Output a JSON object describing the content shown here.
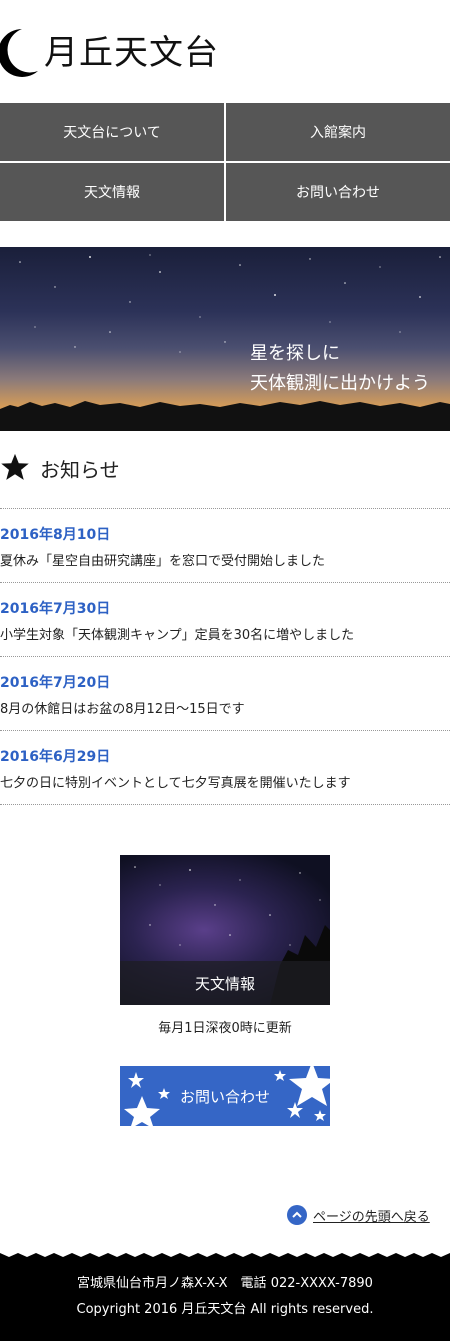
{
  "site": {
    "title": "月丘天文台"
  },
  "nav": {
    "items": [
      {
        "label": "天文台について"
      },
      {
        "label": "入館案内"
      },
      {
        "label": "天文情報"
      },
      {
        "label": "お問い合わせ"
      }
    ]
  },
  "hero": {
    "line1": "星を探しに",
    "line2": "天体観測に出かけよう"
  },
  "news": {
    "title": "お知らせ",
    "items": [
      {
        "date": "2016年8月10日",
        "text": "夏休み「星空自由研究講座」を窓口で受付開始しました"
      },
      {
        "date": "2016年7月30日",
        "text": "小学生対象「天体観測キャンプ」定員を30名に増やしました"
      },
      {
        "date": "2016年7月20日",
        "text": "8月の休館日はお盆の8月12日～15日です"
      },
      {
        "date": "2016年6月29日",
        "text": "七夕の日に特別イベントとして七夕写真展を開催いたします"
      }
    ]
  },
  "info": {
    "card_label": "天文情報",
    "caption": "毎月1日深夜0時に更新"
  },
  "contact": {
    "label": "お問い合わせ"
  },
  "totop": {
    "label": "ページの先頭へ戻る"
  },
  "footer": {
    "address": "宮城県仙台市月ノ森X-X-X　電話 022-XXXX-7890",
    "copyright": "Copyright 2016 月丘天文台 All rights reserved."
  },
  "colors": {
    "accent": "#2d61c4",
    "nav_bg": "#565656",
    "button_bg": "#3566c6",
    "footer_bg": "#000000"
  },
  "icons": [
    "moon-logo-icon",
    "star-icon",
    "chevron-up-icon"
  ]
}
